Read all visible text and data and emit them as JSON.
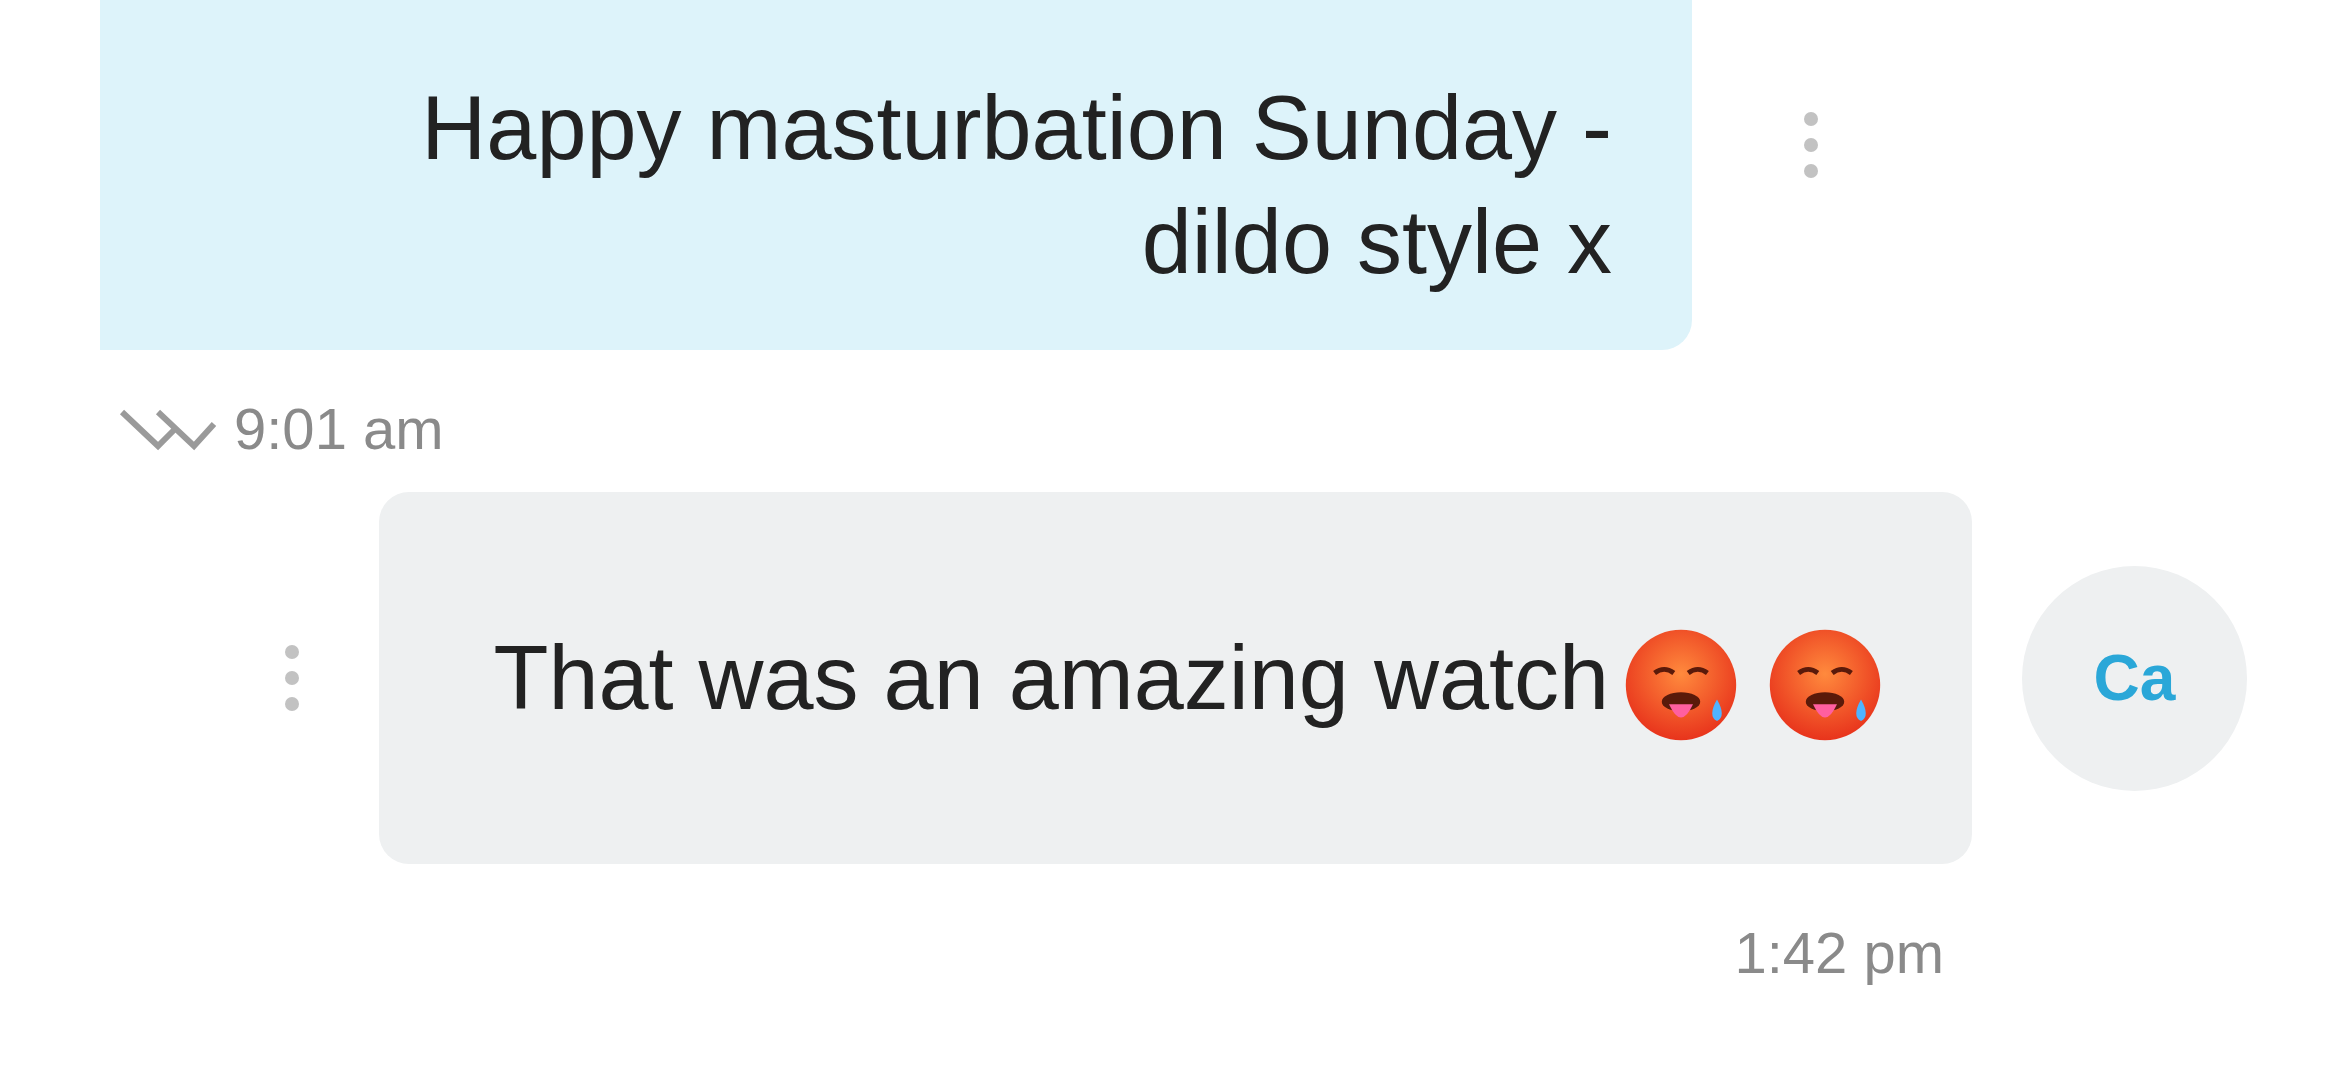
{
  "messages": [
    {
      "kind": "sent",
      "text": "Happy masturbation Sunday - dildo style x",
      "time": "9:01 am",
      "read": true
    },
    {
      "kind": "received",
      "text": "That was an amazing watch",
      "emojis": [
        {
          "kind": "hot_face"
        },
        {
          "kind": "hot_face"
        }
      ],
      "time": "1:42 pm",
      "avatar": {
        "initials": "Ca"
      }
    }
  ]
}
